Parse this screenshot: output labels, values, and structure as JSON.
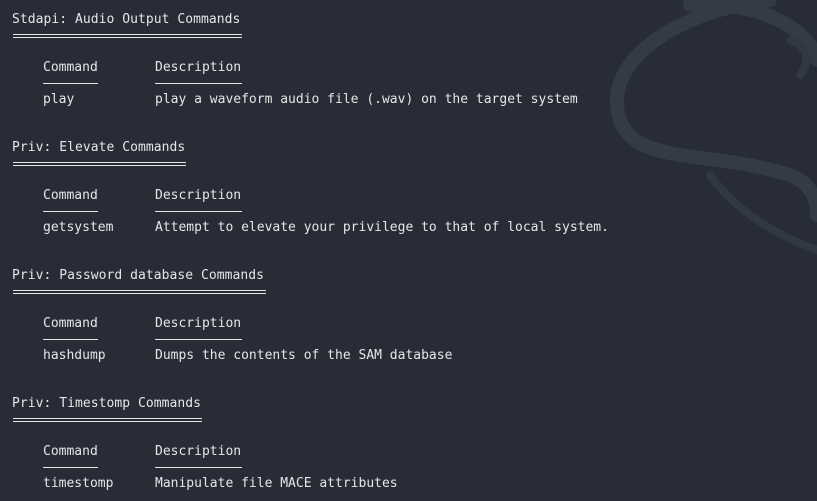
{
  "sections": [
    {
      "title": "Stdapi: Audio Output Commands",
      "columns": [
        "Command",
        "Description"
      ],
      "rows": [
        {
          "command": "play",
          "description": "play a waveform audio file (.wav) on the target system"
        }
      ]
    },
    {
      "title": "Priv: Elevate Commands",
      "columns": [
        "Command",
        "Description"
      ],
      "rows": [
        {
          "command": "getsystem",
          "description": "Attempt to elevate your privilege to that of local system."
        }
      ]
    },
    {
      "title": "Priv: Password database Commands",
      "columns": [
        "Command",
        "Description"
      ],
      "rows": [
        {
          "command": "hashdump",
          "description": "Dumps the contents of the SAM database"
        }
      ]
    },
    {
      "title": "Priv: Timestomp Commands",
      "columns": [
        "Command",
        "Description"
      ],
      "rows": [
        {
          "command": "timestomp",
          "description": "Manipulate file MACE attributes"
        }
      ]
    }
  ],
  "icons": {
    "background": "kali-dragon-icon"
  },
  "colors": {
    "background": "#272c36",
    "text": "#e6e6e6"
  }
}
